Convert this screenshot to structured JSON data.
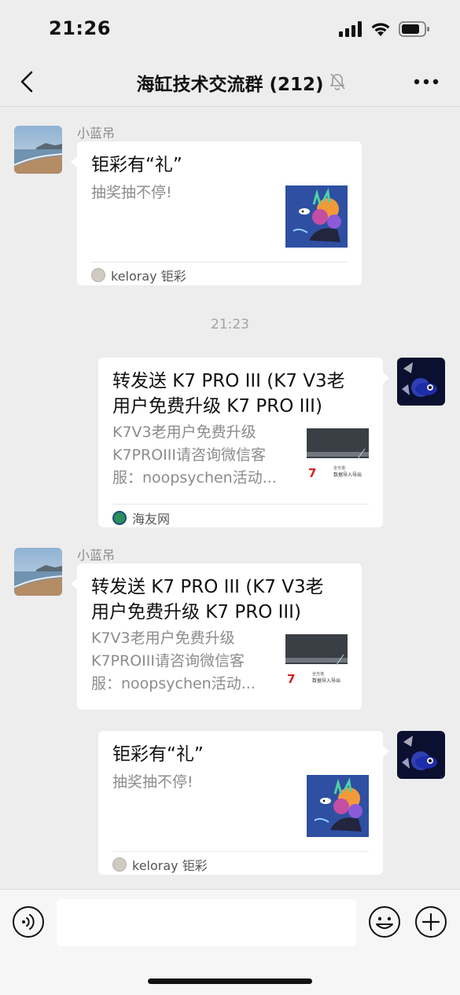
{
  "status_bar": {
    "time": "21:26",
    "icons": [
      "cellular-signal-icon",
      "wifi-icon",
      "battery-icon"
    ]
  },
  "nav": {
    "back_icon": "chevron-left-icon",
    "title": "海缸技术交流群 (212)",
    "mute_icon": "bell-muted-icon",
    "more_icon": "ellipsis-icon"
  },
  "messages": [
    {
      "side": "left",
      "sender": "小蓝吊",
      "card": {
        "title": "钜彩有“礼”",
        "desc": "抽奖抽不停!",
        "source": "keloray 钜彩"
      }
    },
    {
      "side": "time",
      "text": "21:23"
    },
    {
      "side": "right",
      "card": {
        "title_line1": "转发送 K7 PRO III (K7 V3老",
        "title_line2": "用户免费升级 K7 PRO III)",
        "desc_line1": "K7V3老用户免费升级",
        "desc_line2": "K7PROIII请咨询微信客",
        "desc_line3": "服：noopsychen活动...",
        "source": "海友网"
      }
    },
    {
      "side": "left",
      "sender": "小蓝吊",
      "card": {
        "title_line1": "转发送 K7 PRO III (K7 V3老",
        "title_line2": "用户免费升级 K7 PRO III)",
        "desc_line1": "K7V3老用户免费升级",
        "desc_line2": "K7PROIII请咨询微信客",
        "desc_line3": "服：noopsychen活动..."
      }
    },
    {
      "side": "right",
      "card": {
        "title": "钜彩有“礼”",
        "desc": "抽奖抽不停!",
        "source": "keloray 钜彩"
      }
    }
  ],
  "input_bar": {
    "voice_icon": "voice-icon",
    "emoji_icon": "emoji-icon",
    "plus_icon": "plus-icon"
  },
  "colors": {
    "background": "#ededed",
    "bubble": "#ffffff",
    "secondary_text": "#8c8c8c"
  }
}
